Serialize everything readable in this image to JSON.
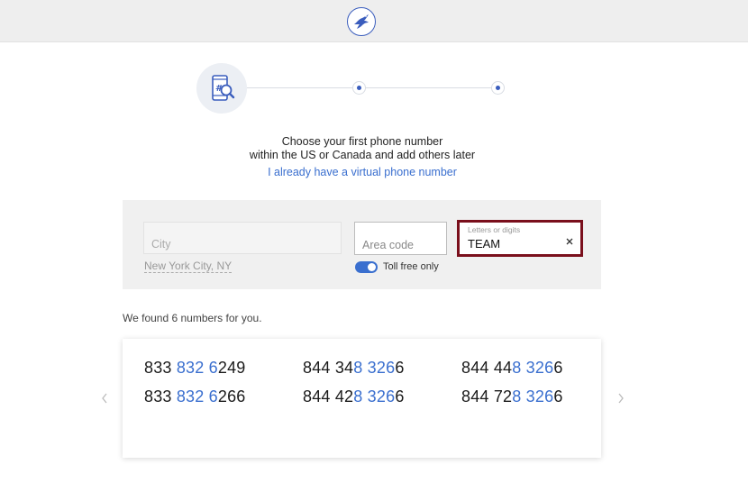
{
  "header": {
    "logo_icon": "bird-logo-icon",
    "accent": "#3a5dbd"
  },
  "stepper": {
    "step1_icon": "phone-search-icon",
    "current_step": 1,
    "total_steps": 3
  },
  "intro": {
    "line1": "Choose your first phone number",
    "line2": "within the US or Canada and add others later",
    "virtual_link": "I already have a virtual phone number"
  },
  "search": {
    "city_placeholder": "City",
    "city_hint": "New York City, NY",
    "area_placeholder": "Area code",
    "toll_free_label": "Toll free only",
    "toll_free_on": true,
    "letters_label": "Letters or digits",
    "letters_value": "TEAM",
    "highlight_color": "#7a0f1c"
  },
  "results": {
    "found_text": "We found 6 numbers for you.",
    "numbers": [
      {
        "a": "833 ",
        "b": "832 6",
        "c": "249"
      },
      {
        "a": "844 34",
        "b": "8 326",
        "c": "6"
      },
      {
        "a": "844 44",
        "b": "8 326",
        "c": "6"
      },
      {
        "a": "833 ",
        "b": "832 6",
        "c": "266"
      },
      {
        "a": "844 42",
        "b": "8 326",
        "c": "6"
      },
      {
        "a": "844 72",
        "b": "8 326",
        "c": "6"
      }
    ],
    "prev_icon": "chevron-left-icon",
    "next_icon": "chevron-right-icon"
  }
}
